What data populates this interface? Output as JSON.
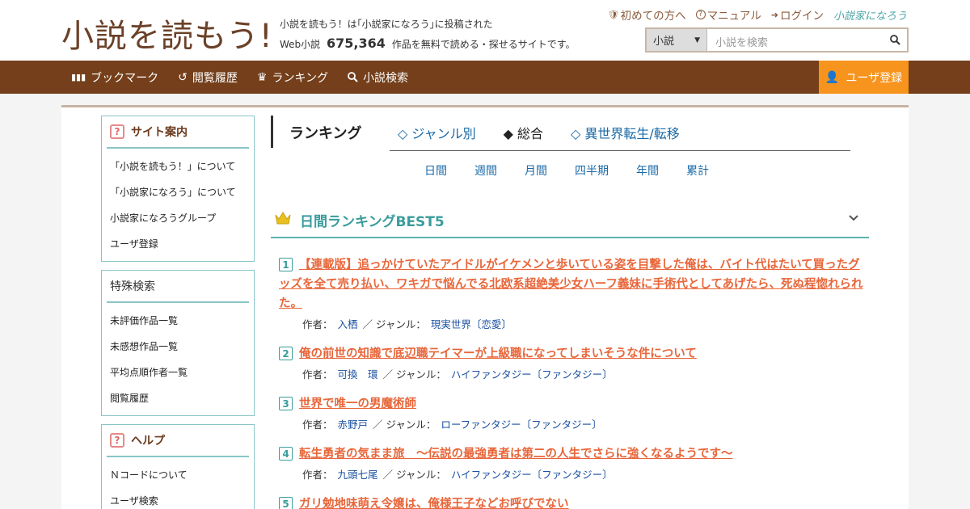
{
  "header": {
    "logo_text": "小説を読もう!",
    "tagline_line1": "小説を読もう！は｢小説家になろう｣に投稿された",
    "tagline_prefix": "Web小説",
    "work_count": "675,364",
    "tagline_suffix": "作品を無料で読める・探せるサイトです。",
    "links": {
      "first_time": "初めての方へ",
      "manual": "マニュアル",
      "login": "ログイン",
      "narou": "小説家になろう"
    },
    "search": {
      "category": "小説",
      "placeholder": "小説を検索"
    }
  },
  "nav": {
    "bookmark": "ブックマーク",
    "history": "閲覧履歴",
    "ranking": "ランキング",
    "search": "小説検索",
    "register": "ユーザ登録"
  },
  "sidebar": {
    "site_guide": {
      "title": "サイト案内",
      "items": [
        "「小説を読もう！」について",
        "「小説家になろう」について",
        "小説家になろうグループ",
        "ユーザ登録"
      ]
    },
    "special_search": {
      "title": "特殊検索",
      "items": [
        "未評価作品一覧",
        "未感想作品一覧",
        "平均点順作者一覧",
        "閲覧履歴"
      ]
    },
    "help": {
      "title": "ヘルプ",
      "items": [
        "Ｎコードについて",
        "ユーザ検索"
      ]
    }
  },
  "ranking": {
    "title": "ランキング",
    "tabs": [
      "◇ ジャンル別",
      "◆ 総合",
      "◇ 異世界転生/転移"
    ],
    "periods": [
      "日間",
      "週間",
      "月間",
      "四半期",
      "年間",
      "累計"
    ],
    "best_title": "日間ランキングBEST5",
    "author_label": "作者：",
    "genre_label": "／ ジャンル：",
    "entries": [
      {
        "rank": "1",
        "title": "【連載版】追っかけていたアイドルがイケメンと歩いている姿を目撃した俺は、バイト代はたいて買ったグッズを全て売り払い、ワキガで悩んでる北欧系超絶美少女ハーフ義妹に手術代としてあげたら、死ぬ程惚れられた。",
        "author": "入栖",
        "genre": "現実世界〔恋愛〕"
      },
      {
        "rank": "2",
        "title": "俺の前世の知識で底辺職テイマーが上級職になってしまいそうな件について",
        "author": "可換　環",
        "genre": "ハイファンタジー〔ファンタジー〕"
      },
      {
        "rank": "3",
        "title": "世界で唯一の男魔術師",
        "author": "赤野戸",
        "genre": "ローファンタジー〔ファンタジー〕"
      },
      {
        "rank": "4",
        "title": "転生勇者の気まま旅　～伝説の最強勇者は第二の人生でさらに強くなるようです～",
        "author": "九頭七尾",
        "genre": "ハイファンタジー〔ファンタジー〕"
      },
      {
        "rank": "5",
        "title": "ガリ勉地味萌え令嬢は、俺様王子などお呼びでない",
        "author": "",
        "genre": ""
      }
    ]
  }
}
